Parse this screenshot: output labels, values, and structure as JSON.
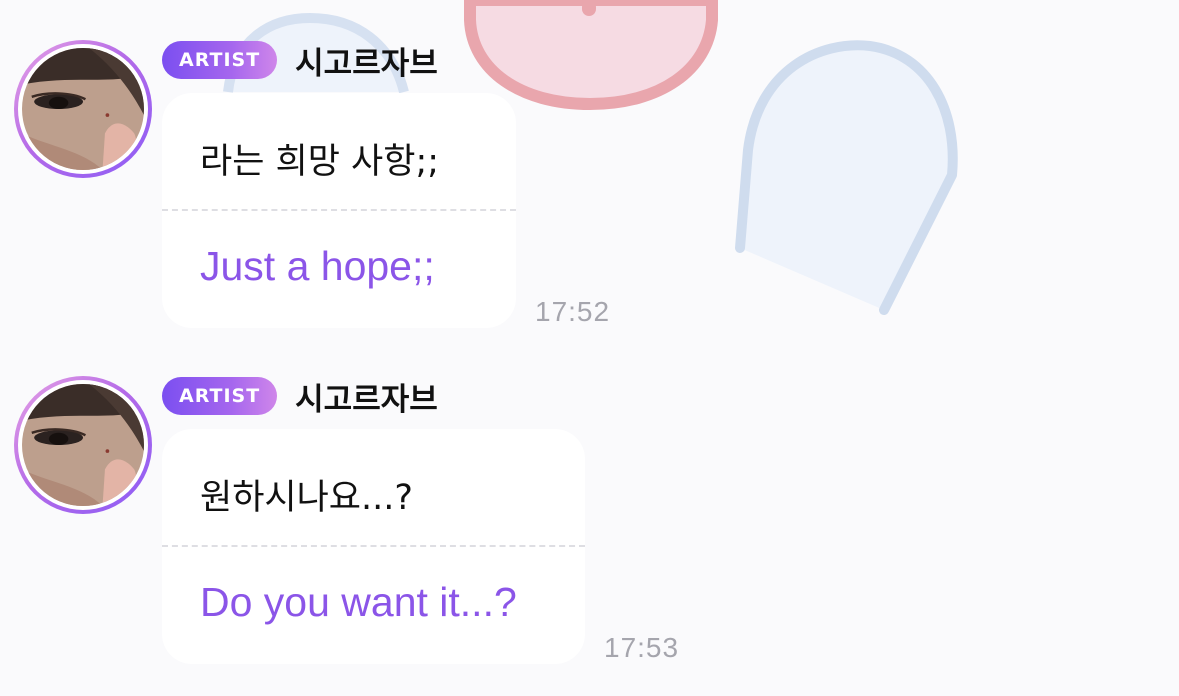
{
  "messages": [
    {
      "badge": "ARTIST",
      "sender": "시고르자브",
      "text": "라는 희망 사항;;",
      "translation": "Just a hope;;",
      "time": "17:52"
    },
    {
      "badge": "ARTIST",
      "sender": "시고르자브",
      "text": "원하시나요...?",
      "translation": "Do you want it...?",
      "time": "17:53"
    }
  ],
  "colors": {
    "background": "#fafafc",
    "bubble": "#ffffff",
    "translation_text": "#8b55e8",
    "badge_gradient_start": "#7b4ff0",
    "badge_gradient_end": "#cf86ea",
    "timestamp": "#a5a5ad"
  },
  "icons": {
    "background_art": "pastel-sticker-doodle",
    "avatar": "artist-profile-photo"
  }
}
